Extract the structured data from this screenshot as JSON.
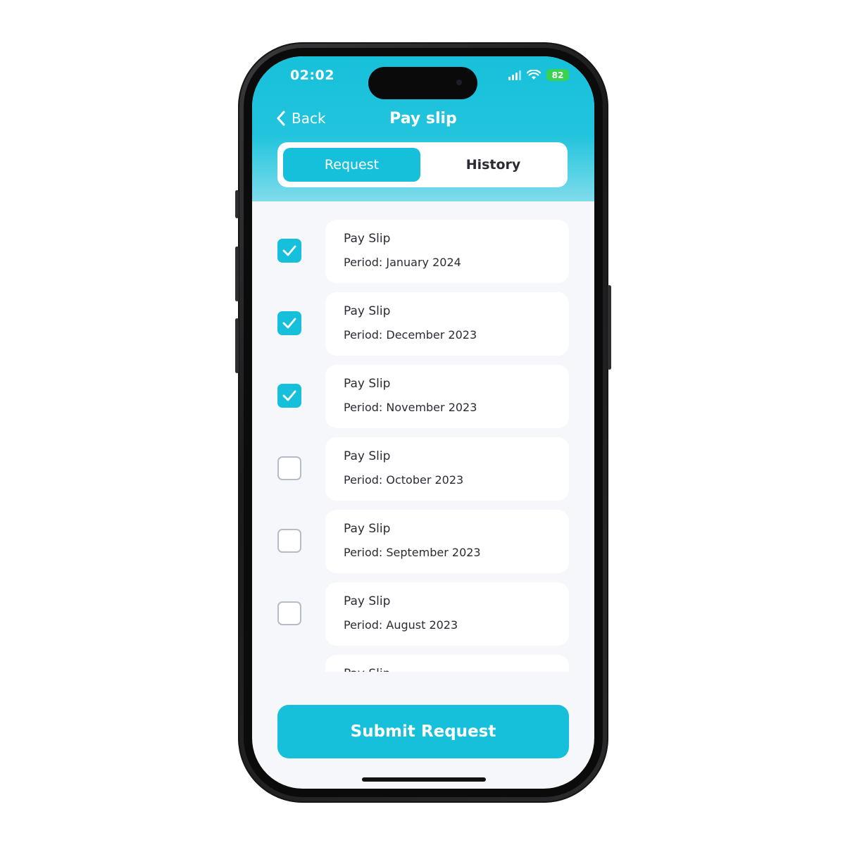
{
  "status_bar": {
    "time": "02:02",
    "battery": "82"
  },
  "header": {
    "back_label": "Back",
    "title": "Pay slip"
  },
  "tabs": [
    {
      "label": "Request",
      "active": true
    },
    {
      "label": "History",
      "active": false
    }
  ],
  "items": [
    {
      "title": "Pay Slip",
      "period": "Period: January 2024",
      "checked": true
    },
    {
      "title": "Pay Slip",
      "period": "Period: December 2023",
      "checked": true
    },
    {
      "title": "Pay Slip",
      "period": "Period: November 2023",
      "checked": true
    },
    {
      "title": "Pay Slip",
      "period": "Period: October 2023",
      "checked": false
    },
    {
      "title": "Pay Slip",
      "period": "Period: September 2023",
      "checked": false
    },
    {
      "title": "Pay Slip",
      "period": "Period: August 2023",
      "checked": false
    },
    {
      "title": "Pay Slip",
      "period": "",
      "checked": false
    }
  ],
  "submit_label": "Submit Request",
  "colors": {
    "accent": "#17c0da",
    "header_gradient_end": "#7fdcec",
    "background": "#f6f7fb",
    "text": "#2b2b35",
    "battery": "#39d353"
  }
}
